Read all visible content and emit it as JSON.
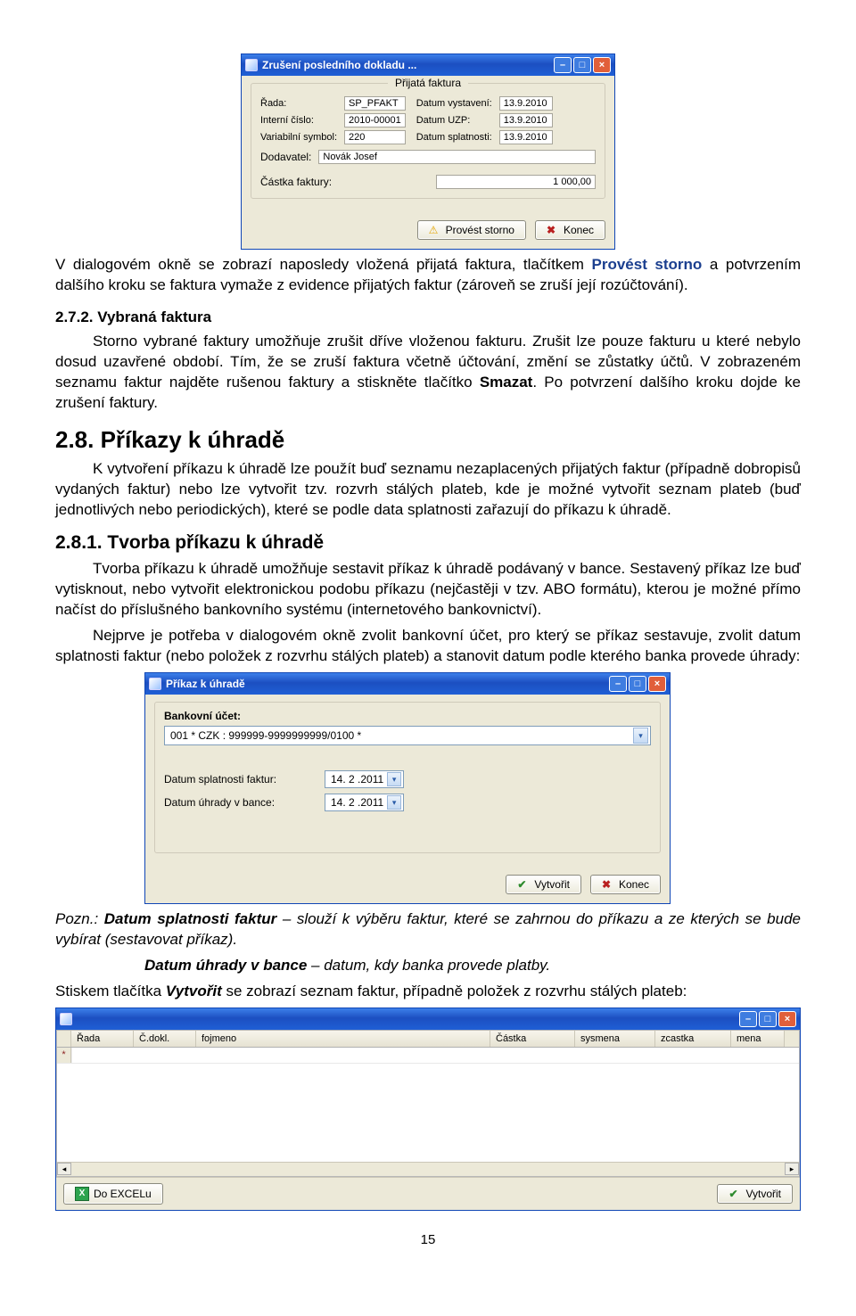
{
  "dialog1": {
    "title": "Zrušení posledního dokladu ...",
    "legend": "Přijatá faktura",
    "labels": {
      "rada": "Řada:",
      "interni": "Interní číslo:",
      "varsym": "Variabilní symbol:",
      "dodavatel": "Dodavatel:",
      "castka": "Částka faktury:",
      "dvyst": "Datum vystavení:",
      "duzp": "Datum UZP:",
      "dspl": "Datum splatnosti:"
    },
    "values": {
      "rada": "SP_PFAKT",
      "interni": "2010-00001",
      "varsym": "220",
      "dodavatel": "Novák Josef",
      "castka": "1 000,00",
      "dvyst": "13.9.2010",
      "duzp": "13.9.2010",
      "dspl": "13.9.2010"
    },
    "buttons": {
      "storno": "Provést storno",
      "konec": "Konec"
    }
  },
  "para1a": "V dialogovém okně se zobrazí naposledy vložená přijatá faktura, tlačítkem ",
  "para1b": "Provést storno",
  "para1c": " a potvrzením dalšího kroku se faktura vymaže z evidence přijatých faktur (zároveň se zruší její rozúčtování).",
  "h272": "2.7.2. Vybraná faktura",
  "p272a": "Storno vybrané faktury umožňuje  zrušit dříve vloženou fakturu. Zrušit lze pouze fakturu u které nebylo dosud uzavřené období.  Tím, že se zruší faktura včetně účtování, změní se zůstatky účtů. V zobrazeném seznamu faktur najděte rušenou faktury a stiskněte tlačítko ",
  "p272b": "Smazat",
  "p272c": ". Po potvrzení dalšího kroku dojde ke zrušení faktury.",
  "h28": "2.8. Příkazy k úhradě",
  "p28": "K vytvoření příkazu k úhradě  lze použít buď seznamu nezaplacených přijatých faktur (případně dobropisů vydaných faktur) nebo lze vytvořit tzv. rozvrh stálých plateb, kde je možné vytvořit seznam plateb (buď jednotlivých nebo periodických), které se podle data splatnosti zařazují do příkazu k úhradě.",
  "h281": "2.8.1. Tvorba příkazu k úhradě",
  "p281a": "Tvorba příkazu k úhradě umožňuje sestavit příkaz k úhradě podávaný v bance. Sestavený příkaz lze buď vytisknout, nebo vytvořit elektronickou podobu příkazu (nejčastěji v tzv. ABO formátu), kterou je možné přímo načíst do příslušného bankovního systému (internetového bankovnictví).",
  "p281b": "Nejprve je potřeba v dialogovém okně zvolit bankovní účet, pro který se příkaz sestavuje, zvolit datum splatnosti faktur (nebo položek z rozvrhu stálých plateb) a stanovit datum podle kterého banka provede úhrady:",
  "dialog2": {
    "title": "Příkaz k úhradě",
    "accountLabel": "Bankovní účet:",
    "accountValue": "001 * CZK : 999999-9999999999/0100 *",
    "splatLabel": "Datum splatnosti faktur:",
    "splatValue": "14. 2 .2011",
    "uhrLabel": "Datum úhrady v bance:",
    "uhrValue": "14. 2 .2011",
    "buttons": {
      "vytvorit": "Vytvořit",
      "konec": "Konec"
    }
  },
  "note1a": "Pozn.:  ",
  "note1b": "Datum splatnosti faktur",
  "note1c": " – slouží k výběru faktur, které se zahrnou do příkazu a ze kterých se bude vybírat (sestavovat příkaz).",
  "note2a": "Datum úhrady v bance",
  "note2b": " – datum, kdy banka provede platby.",
  "p_last_a": "Stiskem tlačítka ",
  "p_last_b": "Vytvořit",
  "p_last_c": " se zobrazí seznam faktur, případně položek z rozvrhu stálých plateb:",
  "dialog3": {
    "columns": [
      "Řada",
      "Č.dokl.",
      "fojmeno",
      "Částka",
      "sysmena",
      "zcastka",
      "mena"
    ],
    "buttons": {
      "excel": "Do EXCELu",
      "vytvorit": "Vytvořit"
    }
  },
  "pagenum": "15"
}
